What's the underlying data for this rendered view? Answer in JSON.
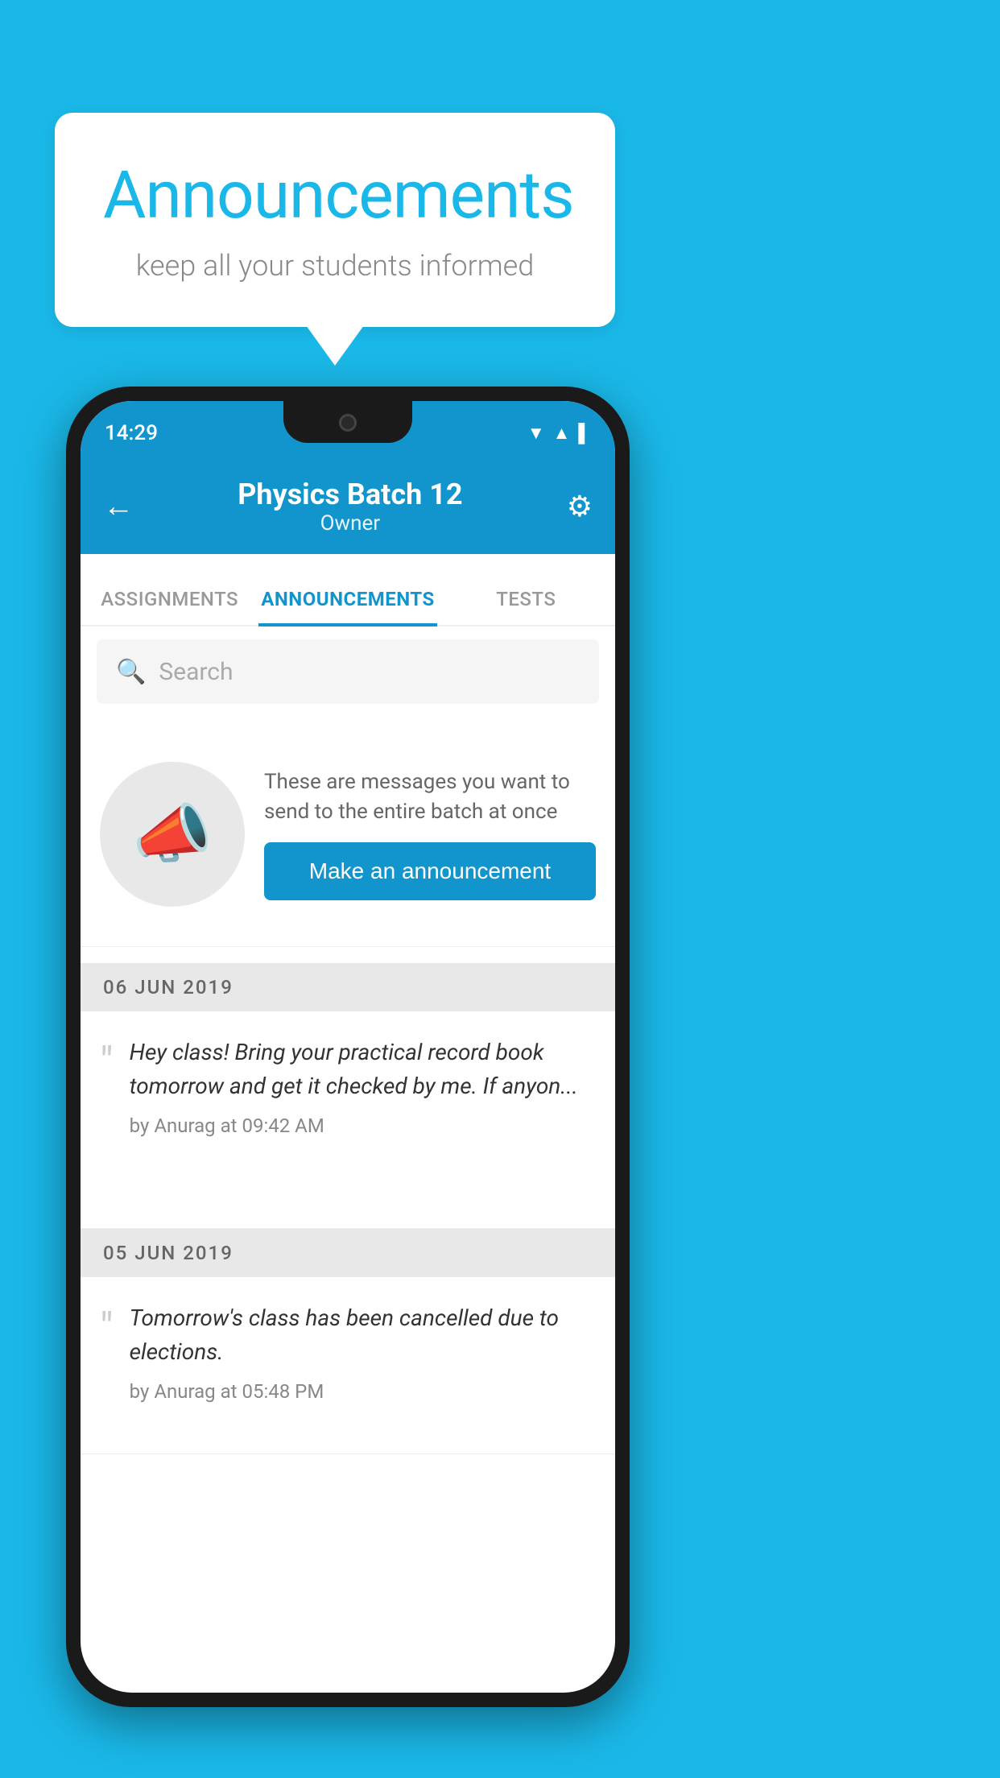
{
  "background": {
    "color": "#1ab8e8"
  },
  "speech_bubble": {
    "title": "Announcements",
    "subtitle": "keep all your students informed"
  },
  "phone": {
    "status_bar": {
      "time": "14:29",
      "wifi_icon": "wifi",
      "signal_icon": "signal",
      "battery_icon": "battery"
    },
    "header": {
      "title": "Physics Batch 12",
      "subtitle": "Owner",
      "back_label": "←",
      "settings_label": "⚙"
    },
    "tabs": [
      {
        "label": "ASSIGNMENTS",
        "active": false
      },
      {
        "label": "ANNOUNCEMENTS",
        "active": true
      },
      {
        "label": "TESTS",
        "active": false
      }
    ],
    "search": {
      "placeholder": "Search"
    },
    "intro": {
      "description": "These are messages you want to send to the entire batch at once",
      "button_label": "Make an announcement"
    },
    "announcements": [
      {
        "date": "06  JUN  2019",
        "text": "Hey class! Bring your practical record book tomorrow and get it checked by me. If anyon...",
        "author": "by Anurag at 09:42 AM"
      },
      {
        "date": "05  JUN  2019",
        "text": "Tomorrow's class has been cancelled due to elections.",
        "author": "by Anurag at 05:48 PM"
      }
    ]
  }
}
